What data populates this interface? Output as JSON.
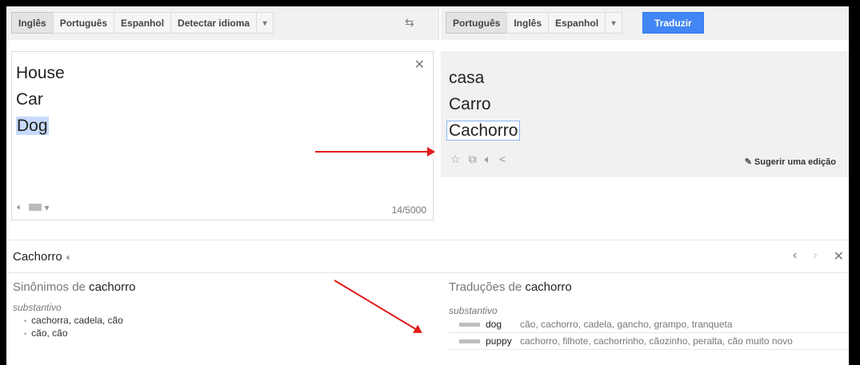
{
  "source_langs": {
    "tabs": [
      "Inglês",
      "Português",
      "Espanhol",
      "Detectar idioma"
    ],
    "dropdown": "▾"
  },
  "target_langs": {
    "tabs": [
      "Português",
      "Inglês",
      "Espanhol"
    ],
    "dropdown": "▾",
    "translate_label": "Traduzir"
  },
  "source": {
    "lines": [
      "House",
      "Car",
      "Dog"
    ],
    "char_count": "14/5000"
  },
  "result": {
    "lines": [
      "casa",
      "Carro",
      "Cachorro"
    ],
    "suggest_label": "Sugerir uma edição"
  },
  "dictionary": {
    "word": "Cachorro",
    "synonyms": {
      "title_prefix": "Sinônimos de",
      "title_word": "cachorro",
      "pos": "substantivo",
      "items": [
        "cachorra, cadela, cão",
        "cão, cão"
      ]
    },
    "translations": {
      "title_prefix": "Traduções de",
      "title_word": "cachorro",
      "pos": "substantivo",
      "rows": [
        {
          "word": "dog",
          "synonyms": "cão, cachorro, cadela, gancho, grampo, tranqueta"
        },
        {
          "word": "puppy",
          "synonyms": "cachorro, filhote, cachorrinho, cãozinho, peralta, cão muito novo"
        }
      ]
    }
  },
  "colors": {
    "accent": "#4285f4",
    "highlight": "#c6dafc",
    "arrow": "#e21b1b"
  }
}
